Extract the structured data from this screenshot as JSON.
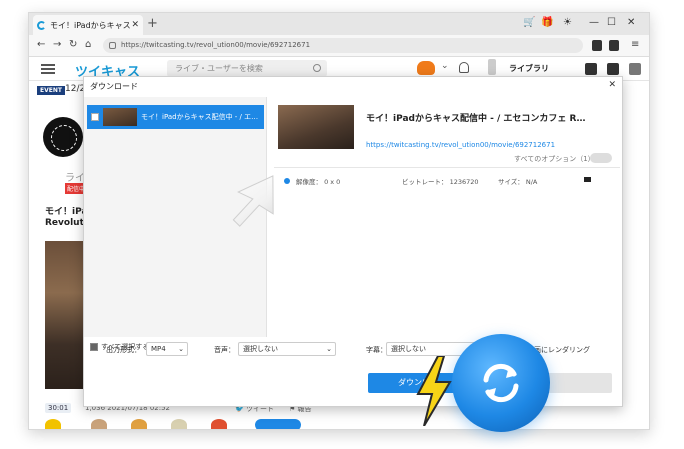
{
  "browser": {
    "tab_title": "モイ！iPadからキャス",
    "url": "https://twitcasting.tv/revol_ution00/movie/692712671"
  },
  "site": {
    "logo": "ツイキャス",
    "search_placeholder": "ライブ・ユーザーを検索",
    "library_label": "ライブラリ",
    "event_badge": "EVENT",
    "event_date": "12/2",
    "side_text": "ライ",
    "live_badge": "配信中",
    "stream_title_line1": "モイ！iPa",
    "stream_title_line2": "Revolut",
    "duration": "30:01",
    "viewers_and_date": "1,036  2021/07/18 02:52",
    "tweet_label": "ツイート",
    "report_label": "報告"
  },
  "dialog": {
    "title": "ダウンロード",
    "item_label": "モイ！iPadからキャス配信中 - / エ…",
    "select_all_label": "すべて選択する(1/1)",
    "detail_title": "モイ！iPadからキャス配信中 - / エセコンカフェ R…",
    "detail_url": "https://twitcasting.tv/revol_ution00/movie/692712671",
    "all_options_label": "すべてのオプション（1）",
    "resolution_label": "解像度：  0 x 0",
    "bitrate_label": "ビットレート：  1236720",
    "size_label": "サイズ：  N/A",
    "output_format_label": "出力形式：",
    "output_format_value": "MP4",
    "audio_label": "音声：",
    "audio_value": "選択しない",
    "subtitle_label": "字幕：",
    "subtitle_value": "選択しない",
    "render_label": "動画にレンダリング",
    "download_button": "ダウンロ"
  },
  "colors": {
    "accent": "#1e88e5",
    "logo": "#1a9bd7",
    "live": "#e53935"
  }
}
